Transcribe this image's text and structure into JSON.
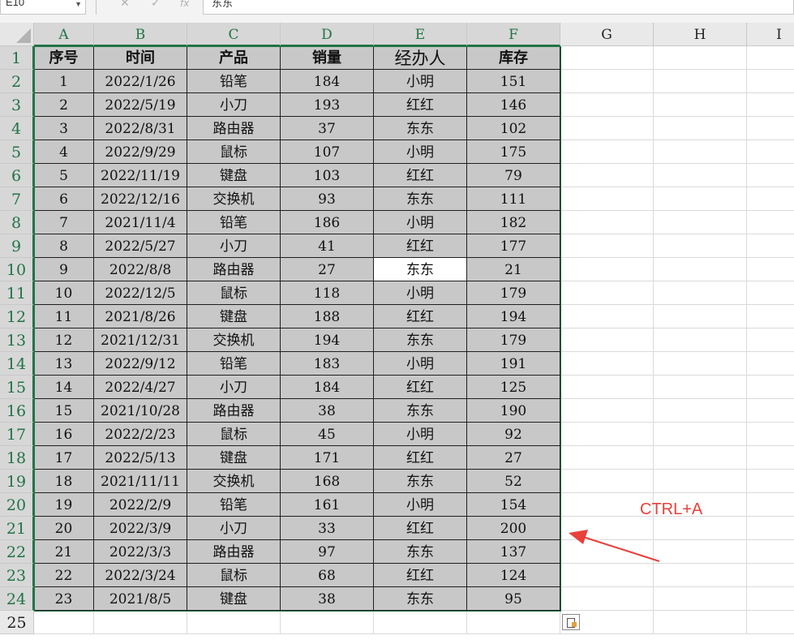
{
  "name_box": {
    "value": "E10"
  },
  "formula_bar": {
    "value": "东东"
  },
  "columns": [
    "A",
    "B",
    "C",
    "D",
    "E",
    "F",
    "G",
    "H",
    "I"
  ],
  "selected_columns": [
    "A",
    "B",
    "C",
    "D",
    "E",
    "F"
  ],
  "rows": [
    "1",
    "2",
    "3",
    "4",
    "5",
    "6",
    "7",
    "8",
    "9",
    "10",
    "11",
    "12",
    "13",
    "14",
    "15",
    "16",
    "17",
    "18",
    "19",
    "20",
    "21",
    "22",
    "23",
    "24",
    "25"
  ],
  "table": {
    "headers": [
      "序号",
      "时间",
      "产品",
      "销量",
      "经办人",
      "库存"
    ],
    "rows": [
      [
        "1",
        "2022/1/26",
        "铅笔",
        "184",
        "小明",
        "151"
      ],
      [
        "2",
        "2022/5/19",
        "小刀",
        "193",
        "红红",
        "146"
      ],
      [
        "3",
        "2022/8/31",
        "路由器",
        "37",
        "东东",
        "102"
      ],
      [
        "4",
        "2022/9/29",
        "鼠标",
        "107",
        "小明",
        "175"
      ],
      [
        "5",
        "2022/11/19",
        "键盘",
        "103",
        "红红",
        "79"
      ],
      [
        "6",
        "2022/12/16",
        "交换机",
        "93",
        "东东",
        "111"
      ],
      [
        "7",
        "2021/11/4",
        "铅笔",
        "186",
        "小明",
        "182"
      ],
      [
        "8",
        "2022/5/27",
        "小刀",
        "41",
        "红红",
        "177"
      ],
      [
        "9",
        "2022/8/8",
        "路由器",
        "27",
        "东东",
        "21"
      ],
      [
        "10",
        "2022/12/5",
        "鼠标",
        "118",
        "小明",
        "179"
      ],
      [
        "11",
        "2021/8/26",
        "键盘",
        "188",
        "红红",
        "194"
      ],
      [
        "12",
        "2021/12/31",
        "交换机",
        "194",
        "东东",
        "179"
      ],
      [
        "13",
        "2022/9/12",
        "铅笔",
        "183",
        "小明",
        "191"
      ],
      [
        "14",
        "2022/4/27",
        "小刀",
        "184",
        "红红",
        "125"
      ],
      [
        "15",
        "2021/10/28",
        "路由器",
        "38",
        "东东",
        "190"
      ],
      [
        "16",
        "2022/2/23",
        "鼠标",
        "45",
        "小明",
        "92"
      ],
      [
        "17",
        "2022/5/13",
        "键盘",
        "171",
        "红红",
        "27"
      ],
      [
        "18",
        "2021/11/11",
        "交换机",
        "168",
        "东东",
        "52"
      ],
      [
        "19",
        "2022/2/9",
        "铅笔",
        "161",
        "小明",
        "154"
      ],
      [
        "20",
        "2022/3/9",
        "小刀",
        "33",
        "红红",
        "200"
      ],
      [
        "21",
        "2022/3/3",
        "路由器",
        "97",
        "东东",
        "137"
      ],
      [
        "22",
        "2022/3/24",
        "鼠标",
        "68",
        "红红",
        "124"
      ],
      [
        "23",
        "2021/8/5",
        "键盘",
        "38",
        "东东",
        "95"
      ]
    ]
  },
  "active_cell": "E10",
  "annotation": {
    "text": "CTRL+A",
    "color": "#e8403a"
  },
  "icons": {
    "cancel": "close-icon",
    "confirm": "check-icon",
    "function": "function-icon",
    "filter": "filter-dropdown-icon",
    "quick_analysis": "quick-analysis-icon"
  },
  "colors": {
    "selection": "#217346",
    "table_fill": "#c8c8c8",
    "annotation": "#e8403a"
  }
}
